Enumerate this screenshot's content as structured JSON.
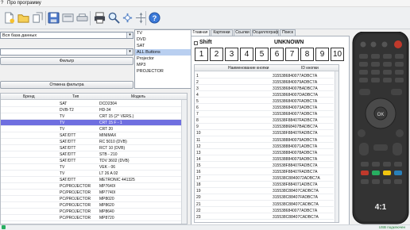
{
  "menu": {
    "item1": "?",
    "item2": "Про программу"
  },
  "toolbar": {
    "icons": [
      "new-icon",
      "open-icon",
      "save-icon",
      "save-as-icon",
      "print-icon",
      "search-icon",
      "settings-icon",
      "help-icon"
    ]
  },
  "filters": {
    "db_combo": "Вся база данных",
    "combo2": "",
    "filter_button": "Фильтр",
    "reset_button": "Отмена фильтра"
  },
  "types": [
    "TV",
    "DVD",
    "SAT",
    "ALL Buttons",
    "Projector",
    "MP3",
    "PROJECTOR"
  ],
  "types_selected": 3,
  "devices": {
    "headers": {
      "brand": "Бренд",
      "type": "Тип",
      "model": "Модель"
    },
    "rows": [
      {
        "type": "SAT",
        "model": "DCD2304"
      },
      {
        "type": "DVB-T2",
        "model": "HD-34"
      },
      {
        "type": "TV",
        "model": "CRT 15 (2^ VERS.)"
      },
      {
        "type": "TV",
        "model": "CRT 15 F - 1"
      },
      {
        "type": "TV",
        "model": "CRT 20"
      },
      {
        "type": "SAT/DTT",
        "model": "MINIMAX"
      },
      {
        "type": "SAT/DTT",
        "model": "RC 5010 (DVB)"
      },
      {
        "type": "SAT/DTT",
        "model": "RCT 10 (DVB)"
      },
      {
        "type": "SAT/DTT",
        "model": "STB - 210"
      },
      {
        "type": "SAT/DTT",
        "model": "TDV 3602 (DVB)"
      },
      {
        "type": "TV",
        "model": "VEK - 06"
      },
      {
        "type": "TV",
        "model": "LT 26 A 02"
      },
      {
        "type": "SAT/DTT",
        "model": "METRONIC 441325"
      },
      {
        "type": "PC/PROJECTOR",
        "model": "MP7640I"
      },
      {
        "type": "PC/PROJECTOR",
        "model": "MP7740I"
      },
      {
        "type": "PC/PROJECTOR",
        "model": "MP8020"
      },
      {
        "type": "PC/PROJECTOR",
        "model": "MP8620"
      },
      {
        "type": "PC/PROJECTOR",
        "model": "MP8640"
      },
      {
        "type": "PC/PROJECTOR",
        "model": "MP8720"
      }
    ],
    "selected_index": 3
  },
  "tabs": [
    "Главная",
    "Картинки",
    "Ссылки",
    "Осциллограф",
    "Поиск"
  ],
  "shift_label": "Shift",
  "device_title": "UNKNOWN",
  "number_buttons": [
    "1",
    "2",
    "3",
    "4",
    "5",
    "6",
    "7",
    "8",
    "9",
    "10"
  ],
  "codes": {
    "headers": {
      "name": "Наименование кнопки",
      "id": "ID кнопки"
    },
    "rows": [
      {
        "n": "1",
        "id": "3155386840077ADBC7A"
      },
      {
        "n": "2",
        "id": "3155386840079ADBC7A"
      },
      {
        "n": "3",
        "id": "315538684007BADBC7A"
      },
      {
        "n": "4",
        "id": "315538684007DADBC7A"
      },
      {
        "n": "5",
        "id": "315538684007FADBC7A"
      },
      {
        "n": "6",
        "id": "3155386840073ADBC7A"
      },
      {
        "n": "7",
        "id": "3155386840077ADBC7A"
      },
      {
        "n": "8",
        "id": "315538F88407FADBC7A"
      },
      {
        "n": "9",
        "id": "315538868407BADBC7A"
      },
      {
        "n": "10",
        "id": "315538F88407FADBC7A"
      },
      {
        "n": "11",
        "id": "3155388840079ADBC7A"
      },
      {
        "n": "12",
        "id": "3155388840071ADBC7A"
      },
      {
        "n": "13",
        "id": "3155388840078ADBC7A"
      },
      {
        "n": "14",
        "id": "3155388840079ADBC7A"
      },
      {
        "n": "15",
        "id": "315538F88407FADBC7A"
      },
      {
        "n": "16",
        "id": "315538F88407FADBC7A"
      },
      {
        "n": "17",
        "id": "315538C8840072ADBC7A"
      },
      {
        "n": "18",
        "id": "315538F884071ADBC7A"
      },
      {
        "n": "19",
        "id": "315538C88407CADBC7A"
      },
      {
        "n": "20",
        "id": "315538C88407FADBC7A"
      },
      {
        "n": "21",
        "id": "315538C88407CADBC7A"
      },
      {
        "n": "22",
        "id": "3155386840077ADBC7A"
      },
      {
        "n": "23",
        "id": "315538C88407CADBC7A"
      }
    ]
  },
  "remote_label": "4:1",
  "status_left": "",
  "status_right": "USB подключен"
}
